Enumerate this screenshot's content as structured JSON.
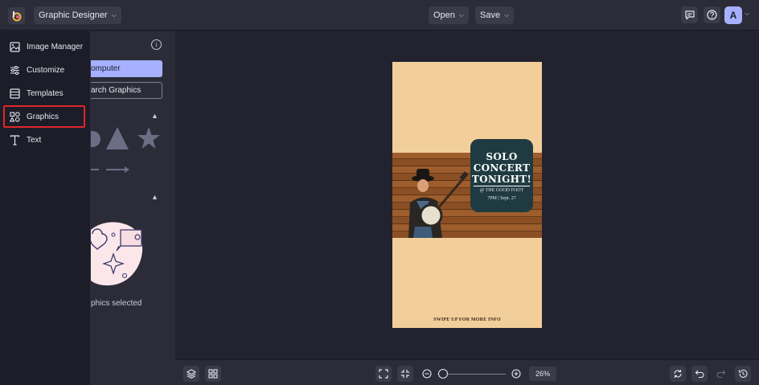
{
  "topbar": {
    "app_switcher": "Graphic Designer",
    "open_label": "Open",
    "save_label": "Save",
    "avatar_initial": "A"
  },
  "menu": {
    "items": [
      {
        "label": "Image Manager",
        "icon": "image-icon"
      },
      {
        "label": "Customize",
        "icon": "sliders-icon"
      },
      {
        "label": "Templates",
        "icon": "templates-icon"
      },
      {
        "label": "Graphics",
        "icon": "graphics-icon",
        "active": true
      },
      {
        "label": "Text",
        "icon": "text-icon"
      }
    ]
  },
  "panel": {
    "upload_button": "omputer",
    "search_button": "arch Graphics",
    "none_selected": "phics selected"
  },
  "design": {
    "title_line1": "SOLO",
    "title_line2": "CONCERT",
    "title_line3": "TONIGHT!",
    "venue": "@ THE GOOD FOOT",
    "time": "7PM | Sept. 27",
    "footer": "SWIPE UP FOR MORE INFO"
  },
  "bottombar": {
    "zoom": "26%",
    "zoom_fraction": 0.02
  },
  "colors": {
    "accent": "#a6b0ff",
    "highlight": "#e0262a",
    "artboard": "#f2cf9a",
    "card": "#1f3b41"
  }
}
